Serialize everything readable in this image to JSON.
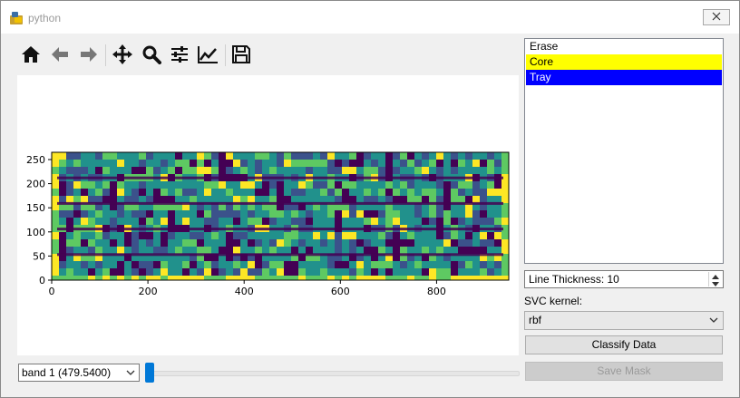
{
  "window": {
    "title": "python"
  },
  "toolbar": {
    "icons": [
      "home-icon",
      "back-icon",
      "forward-icon",
      "pan-icon",
      "zoom-icon",
      "configure-subplots-icon",
      "edit-axis-icon",
      "save-icon"
    ]
  },
  "plot": {
    "x_ticks": [
      "0",
      "200",
      "400",
      "600",
      "800"
    ],
    "y_ticks": [
      "0",
      "50",
      "100",
      "150",
      "200",
      "250"
    ],
    "colormap": [
      "#440154",
      "#3b528b",
      "#21918c",
      "#5ec962",
      "#fde725"
    ]
  },
  "band_select": {
    "value": "band 1 (479.5400)"
  },
  "slider": {
    "value_fraction": 0.0,
    "accent": "#0078d7"
  },
  "class_list": {
    "items": [
      {
        "label": "Erase",
        "bg": "#ffffff",
        "fg": "#000000"
      },
      {
        "label": "Core",
        "bg": "#ffff00",
        "fg": "#000000"
      },
      {
        "label": "Tray",
        "bg": "#0000ff",
        "fg": "#ffffff"
      }
    ]
  },
  "line_thickness": {
    "label": "Line Thickness:",
    "value": "10"
  },
  "kernel": {
    "label": "SVC kernel:",
    "value": "rbf"
  },
  "buttons": {
    "classify": "Classify Data",
    "save_mask": "Save Mask"
  }
}
